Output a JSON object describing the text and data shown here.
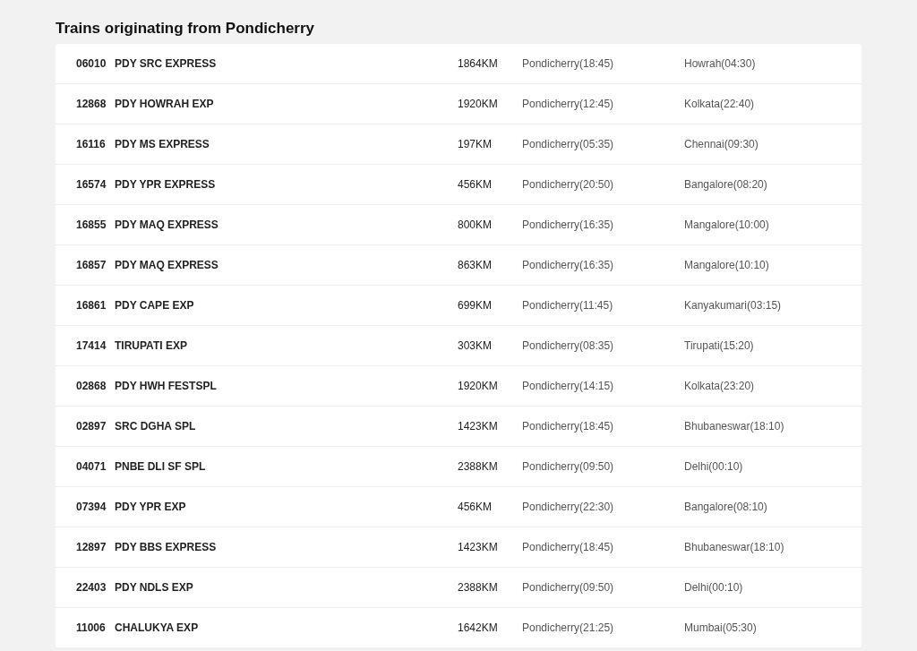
{
  "title": "Trains originating from Pondicherry",
  "trains": [
    {
      "number": "06010",
      "name": "PDY SRC EXPRESS",
      "distance": "1864KM",
      "departure": "Pondicherry(18:45)",
      "arrival": "Howrah(04:30)"
    },
    {
      "number": "12868",
      "name": "PDY HOWRAH EXP",
      "distance": "1920KM",
      "departure": "Pondicherry(12:45)",
      "arrival": "Kolkata(22:40)"
    },
    {
      "number": "16116",
      "name": "PDY MS EXPRESS",
      "distance": "197KM",
      "departure": "Pondicherry(05:35)",
      "arrival": "Chennai(09:30)"
    },
    {
      "number": "16574",
      "name": "PDY YPR EXPRESS",
      "distance": "456KM",
      "departure": "Pondicherry(20:50)",
      "arrival": "Bangalore(08:20)"
    },
    {
      "number": "16855",
      "name": "PDY MAQ EXPRESS",
      "distance": "800KM",
      "departure": "Pondicherry(16:35)",
      "arrival": "Mangalore(10:00)"
    },
    {
      "number": "16857",
      "name": "PDY MAQ EXPRESS",
      "distance": "863KM",
      "departure": "Pondicherry(16:35)",
      "arrival": "Mangalore(10:10)"
    },
    {
      "number": "16861",
      "name": "PDY CAPE EXP",
      "distance": "699KM",
      "departure": "Pondicherry(11:45)",
      "arrival": "Kanyakumari(03:15)"
    },
    {
      "number": "17414",
      "name": "TIRUPATI EXP",
      "distance": "303KM",
      "departure": "Pondicherry(08:35)",
      "arrival": "Tirupati(15:20)"
    },
    {
      "number": "02868",
      "name": "PDY HWH FESTSPL",
      "distance": "1920KM",
      "departure": "Pondicherry(14:15)",
      "arrival": "Kolkata(23:20)"
    },
    {
      "number": "02897",
      "name": "SRC DGHA SPL",
      "distance": "1423KM",
      "departure": "Pondicherry(18:45)",
      "arrival": "Bhubaneswar(18:10)"
    },
    {
      "number": "04071",
      "name": "PNBE DLI SF SPL",
      "distance": "2388KM",
      "departure": "Pondicherry(09:50)",
      "arrival": "Delhi(00:10)"
    },
    {
      "number": "07394",
      "name": "PDY YPR EXP",
      "distance": "456KM",
      "departure": "Pondicherry(22:30)",
      "arrival": "Bangalore(08:10)"
    },
    {
      "number": "12897",
      "name": "PDY BBS EXPRESS",
      "distance": "1423KM",
      "departure": "Pondicherry(18:45)",
      "arrival": "Bhubaneswar(18:10)"
    },
    {
      "number": "22403",
      "name": "PDY NDLS EXP",
      "distance": "2388KM",
      "departure": "Pondicherry(09:50)",
      "arrival": "Delhi(00:10)"
    },
    {
      "number": "11006",
      "name": "CHALUKYA EXP",
      "distance": "1642KM",
      "departure": "Pondicherry(21:25)",
      "arrival": "Mumbai(05:30)"
    }
  ]
}
